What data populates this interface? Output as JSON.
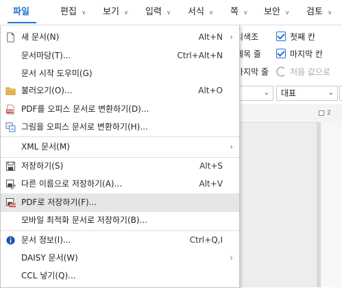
{
  "menubar": {
    "tabs": [
      {
        "label": "파일",
        "active": true
      },
      {
        "label": "편집"
      },
      {
        "label": "보기"
      },
      {
        "label": "입력"
      },
      {
        "label": "서식"
      },
      {
        "label": "쪽"
      },
      {
        "label": "보안"
      },
      {
        "label": "검토"
      }
    ]
  },
  "ribbon": {
    "row1_partial": "리색조",
    "row2_partial": "제목 줄",
    "row3_partial": "마지막 줄",
    "first_col_label": "첫째 칸",
    "last_col_label": "마지막 칸",
    "reset_label": "처음 값으로"
  },
  "style_toolbar": {
    "style_value": "대표"
  },
  "ruler": {
    "number": "2"
  },
  "file_menu": {
    "new_doc": {
      "label": "새 문서(N)",
      "shortcut": "Alt+N",
      "has_submenu": true
    },
    "doc_template": {
      "label": "문서마당(T)...",
      "shortcut": "Ctrl+Alt+N"
    },
    "start_wizard": {
      "label": "문서 시작 도우미(G)"
    },
    "open": {
      "label": "불러오기(O)...",
      "shortcut": "Alt+O"
    },
    "pdf_to_office": {
      "label": "PDF를 오피스 문서로 변환하기(D)..."
    },
    "image_to_office": {
      "label": "그림을 오피스 문서로 변환하기(H)..."
    },
    "xml_doc": {
      "label": "XML 문서(M)",
      "has_submenu": true
    },
    "save": {
      "label": "저장하기(S)",
      "shortcut": "Alt+S"
    },
    "save_as": {
      "label": "다른 이름으로 저장하기(A)...",
      "shortcut": "Alt+V"
    },
    "save_pdf": {
      "label": "PDF로 저장하기(F)...",
      "highlighted": true
    },
    "save_mobile": {
      "label": "모바일 최적화 문서로 저장하기(B)..."
    },
    "doc_info": {
      "label": "문서 정보(I)...",
      "shortcut": "Ctrl+Q,I"
    },
    "daisy": {
      "label": "DAISY 문서(W)",
      "has_submenu": true
    },
    "ccl": {
      "label": "CCL 넣기(Q)..."
    }
  },
  "colors": {
    "accent": "#1f6fd6",
    "highlight": "#e6e6e6",
    "pdf_red": "#c9332b",
    "folder": "#e8b24a"
  }
}
